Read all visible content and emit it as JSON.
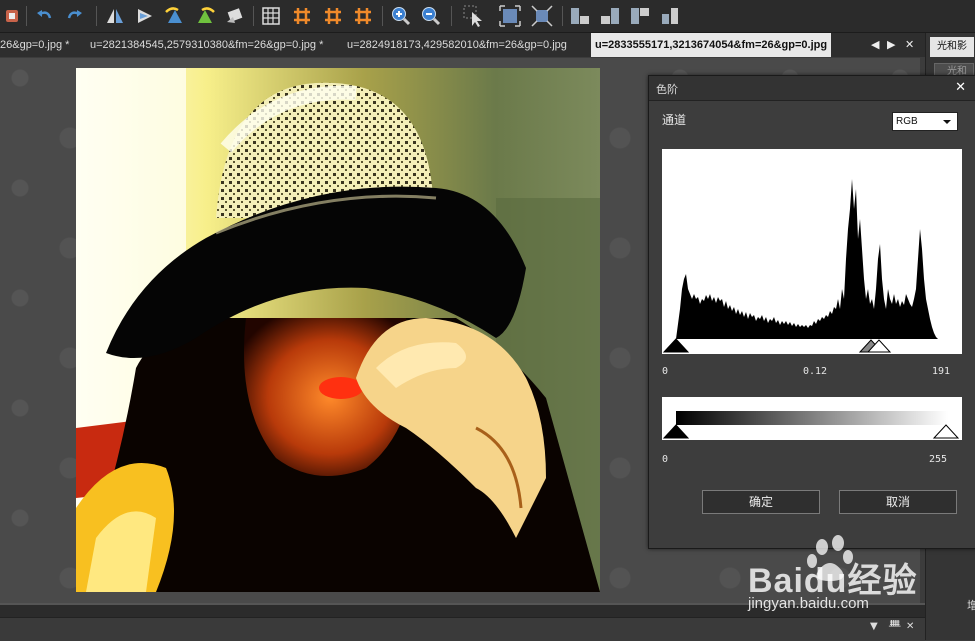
{
  "toolbar": {
    "icons": [
      "app-icon",
      "undo-icon",
      "redo-icon",
      "flip-horizontal-icon",
      "flip-vertical-icon",
      "rotate-left-icon",
      "rotate-right-icon",
      "free-rotate-icon",
      "grid-icon",
      "guide-icon",
      "guide2-icon",
      "guide3-icon",
      "zoom-in-icon",
      "zoom-out-icon",
      "cursor-icon",
      "fit-window-icon",
      "actual-size-icon",
      "align-left-icon",
      "align-right-icon",
      "align-top-icon",
      "align-bottom-icon"
    ]
  },
  "tabs": [
    {
      "label": "26&gp=0.jpg *",
      "active": false
    },
    {
      "label": "u=2821384545,2579310380&fm=26&gp=0.jpg *",
      "active": false
    },
    {
      "label": "u=2824918173,429582010&fm=26&gp=0.jpg",
      "active": false
    },
    {
      "label": "u=2833555171,3213674054&fm=26&gp=0.jpg",
      "active": true
    }
  ],
  "tab_controls": {
    "left": "◀",
    "right": "▶",
    "close": "✕"
  },
  "right_panel": {
    "title": "光和影",
    "item": "光和",
    "side_text": "增"
  },
  "bottom_controls": {
    "dropdown": "▼",
    "pin": "ᚙ",
    "close": "✕"
  },
  "dialog": {
    "title": "色阶",
    "close": "✕",
    "channel_label": "通道",
    "channel_value": "RGB",
    "input_min": "0",
    "input_mid": "0.12",
    "input_max": "191",
    "output_min": "0",
    "output_max": "255",
    "ok_label": "确定",
    "cancel_label": "取消"
  },
  "watermark": {
    "brand": "Baidu经验",
    "url": "jingyan.baidu.com"
  }
}
